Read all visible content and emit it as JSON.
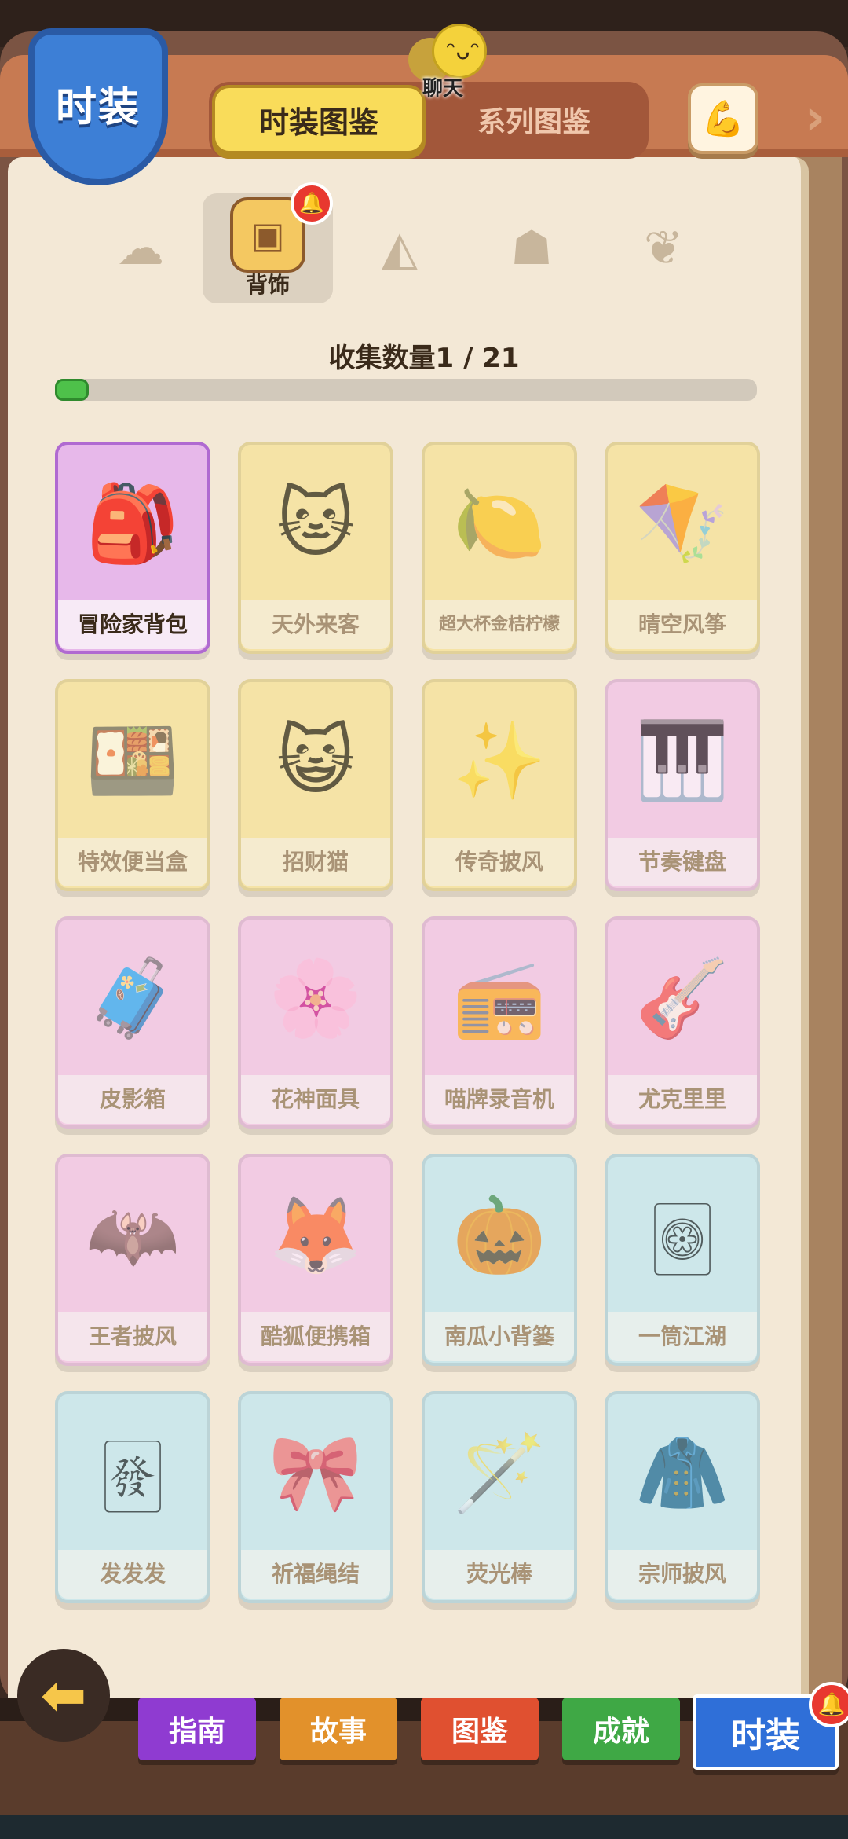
{
  "header": {
    "badge": "时装",
    "tabs": [
      "时装图鉴",
      "系列图鉴"
    ],
    "chat_label": "聊天",
    "colors": {
      "tab_active": "#f9dc5a",
      "badge": "#3d7fd6"
    }
  },
  "categories": [
    {
      "icon": "hair-icon",
      "label": ""
    },
    {
      "icon": "backpack-icon",
      "label": "背饰"
    },
    {
      "icon": "pants-icon",
      "label": ""
    },
    {
      "icon": "outfit-icon",
      "label": ""
    },
    {
      "icon": "wing-icon",
      "label": ""
    }
  ],
  "collect": {
    "text": "收集数量1 / 21",
    "collected": 1,
    "total": 21
  },
  "items": [
    {
      "name": "冒险家背包",
      "color": "purple",
      "icon": "🎒",
      "owned": true
    },
    {
      "name": "天外来客",
      "color": "yellow",
      "icon": "🐱"
    },
    {
      "name": "超大杯金桔柠檬",
      "color": "yellow",
      "icon": "🍋",
      "small": true
    },
    {
      "name": "晴空风筝",
      "color": "yellow",
      "icon": "🪁"
    },
    {
      "name": "特效便当盒",
      "color": "yellow",
      "icon": "🍱"
    },
    {
      "name": "招财猫",
      "color": "yellow",
      "icon": "😺"
    },
    {
      "name": "传奇披风",
      "color": "yellow",
      "icon": "✨"
    },
    {
      "name": "节奏键盘",
      "color": "pink",
      "icon": "🎹"
    },
    {
      "name": "皮影箱",
      "color": "pink",
      "icon": "🧳"
    },
    {
      "name": "花神面具",
      "color": "pink",
      "icon": "🌸"
    },
    {
      "name": "喵牌录音机",
      "color": "pink",
      "icon": "📻"
    },
    {
      "name": "尤克里里",
      "color": "pink",
      "icon": "🎸"
    },
    {
      "name": "王者披风",
      "color": "pink",
      "icon": "🦇"
    },
    {
      "name": "酷狐便携箱",
      "color": "pink",
      "icon": "🦊"
    },
    {
      "name": "南瓜小背篓",
      "color": "blue",
      "icon": "🎃"
    },
    {
      "name": "一筒江湖",
      "color": "blue",
      "icon": "🀙"
    },
    {
      "name": "发发发",
      "color": "blue",
      "icon": "🀅"
    },
    {
      "name": "祈福绳结",
      "color": "blue",
      "icon": "🎀"
    },
    {
      "name": "荧光棒",
      "color": "blue",
      "icon": "🪄"
    },
    {
      "name": "宗师披风",
      "color": "blue",
      "icon": "🧥"
    }
  ],
  "bottom_nav": [
    {
      "label": "指南",
      "color": "#8f3bd1"
    },
    {
      "label": "故事",
      "color": "#e2912b"
    },
    {
      "label": "图鉴",
      "color": "#e05030"
    },
    {
      "label": "成就",
      "color": "#3fa845"
    },
    {
      "label": "时装",
      "color": "#2f6fd8"
    }
  ]
}
